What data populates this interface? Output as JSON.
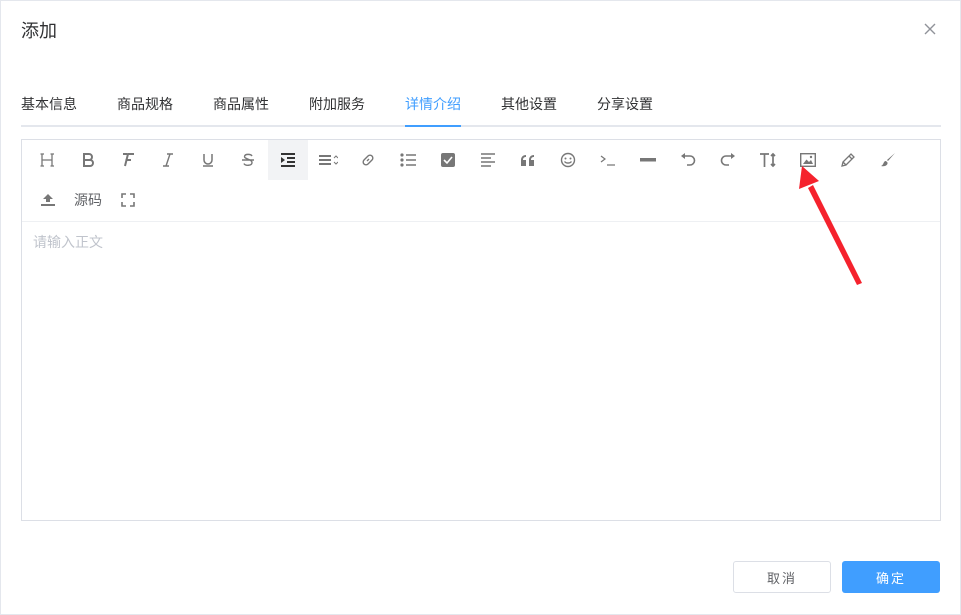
{
  "dialog": {
    "title": "添加",
    "close_icon": "close-icon"
  },
  "tabs": [
    {
      "label": "基本信息",
      "active": false
    },
    {
      "label": "商品规格",
      "active": false
    },
    {
      "label": "商品属性",
      "active": false
    },
    {
      "label": "附加服务",
      "active": false
    },
    {
      "label": "详情介绍",
      "active": true
    },
    {
      "label": "其他设置",
      "active": false
    },
    {
      "label": "分享设置",
      "active": false
    }
  ],
  "editor": {
    "placeholder": "请输入正文",
    "source_label": "源码",
    "toolbar_icons": [
      "heading-icon",
      "bold-icon",
      "font-icon",
      "italic-icon",
      "underline-icon",
      "strikethrough-icon",
      "indent-icon",
      "line-height-icon",
      "link-icon",
      "list-icon",
      "checkbox-icon",
      "align-left-icon",
      "quote-icon",
      "emoji-icon",
      "code-icon",
      "divider-icon",
      "undo-icon",
      "redo-icon",
      "font-size-icon",
      "image-icon",
      "pen-icon",
      "brush-icon",
      "upload-icon",
      "fullscreen-icon"
    ]
  },
  "footer": {
    "cancel_label": "取消",
    "confirm_label": "确定"
  },
  "colors": {
    "accent": "#409eff",
    "annotation_arrow": "#f5222d"
  }
}
